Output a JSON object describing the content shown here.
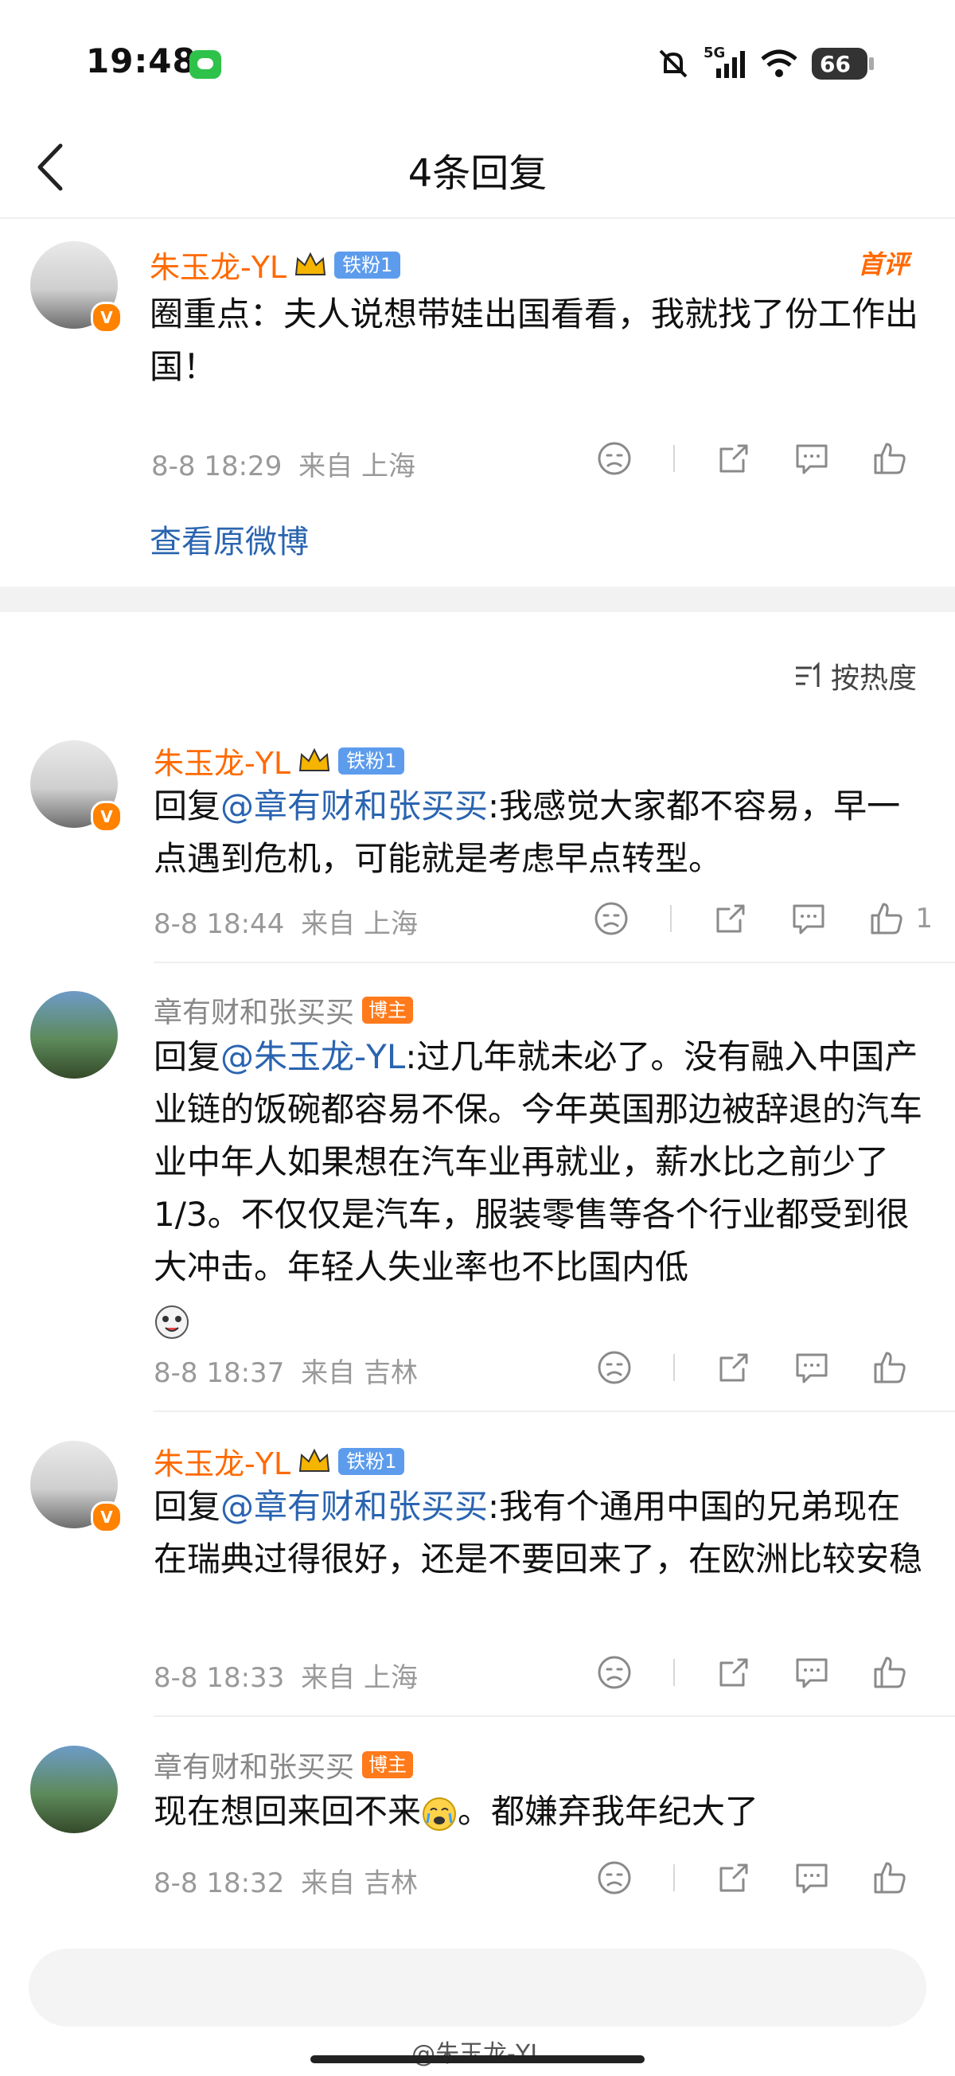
{
  "status_bar": {
    "time": "19:48",
    "network": "5G",
    "battery": "66"
  },
  "nav": {
    "title": "4条回复"
  },
  "main_comment": {
    "author": "朱玉龙-YL",
    "fan_badge": "铁粉1",
    "first_tag": "首评",
    "text": "圈重点：夫人说想带娃出国看看，我就找了份工作出国！",
    "time": "8-8 18:29",
    "location": "来自 上海",
    "view_original": "查看原微博"
  },
  "sort_label": "按热度",
  "replies": [
    {
      "author": "朱玉龙-YL",
      "badge": "铁粉1",
      "prefix": "回复",
      "mention": "@章有财和张买买",
      "text": ":我感觉大家都不容易，早一点遇到危机，可能就是考虑早点转型。",
      "time": "8-8 18:44",
      "location": "来自 上海",
      "likes": "1"
    },
    {
      "author": "章有财和张买买",
      "badge": "博主",
      "prefix": "回复",
      "mention": "@朱玉龙-YL",
      "text": ":过几年就未必了。没有融入中国产业链的饭碗都容易不保。今年英国那边被辞退的汽车业中年人如果想在汽车业再就业，薪水比之前少了1/3。不仅仅是汽车，服装零售等各个行业都受到很大冲击。年轻人失业率也不比国内低",
      "time": "8-8 18:37",
      "location": "来自 吉林"
    },
    {
      "author": "朱玉龙-YL",
      "badge": "铁粉1",
      "prefix": "回复",
      "mention": "@章有财和张买买",
      "text": ":我有个通用中国的兄弟现在在瑞典过得很好，还是不要回来了，在欧洲比较安稳",
      "time": "8-8 18:33",
      "location": "来自 上海"
    },
    {
      "author": "章有财和张买买",
      "badge": "博主",
      "text": "现在想回来回不来",
      "text_after": "。都嫌弃我年纪大了",
      "time": "8-8 18:32",
      "location": "来自 吉林"
    }
  ],
  "watermark": "@朱玉龙-YL",
  "icons": [
    "back-icon",
    "silent-icon",
    "signal-icon",
    "wifi-icon",
    "dislike-icon",
    "share-icon",
    "comment-icon",
    "like-icon",
    "sort-icon",
    "crown-icon",
    "verified-icon",
    "emoji-icon"
  ],
  "colors": {
    "accent_orange": "#ff6a00",
    "link_blue": "#2a64b0",
    "fan_badge": "#5d9cec",
    "blogger_badge": "#ff7a1a"
  }
}
